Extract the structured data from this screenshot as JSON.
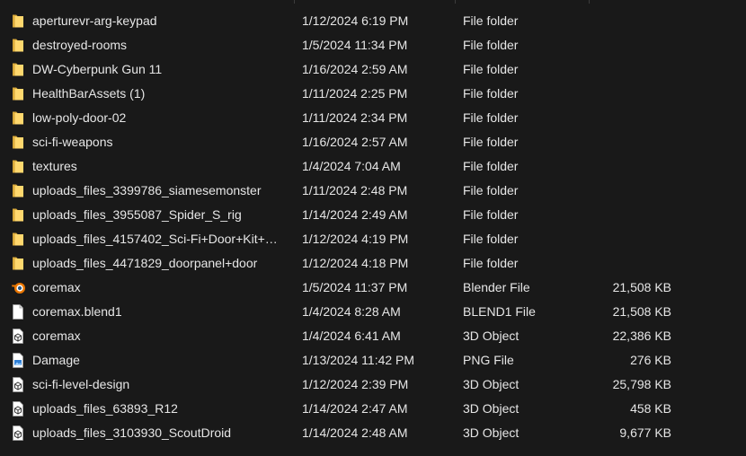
{
  "colors": {
    "background": "#191919",
    "text": "#e6e6e6",
    "folder": "#f2c55c",
    "blender_orange": "#ea7600",
    "blender_blue": "#265787"
  },
  "files": [
    {
      "icon": "folder-icon",
      "name": "aperturevr-arg-keypad",
      "date": "1/12/2024 6:19 PM",
      "type": "File folder",
      "size": ""
    },
    {
      "icon": "folder-icon",
      "name": "destroyed-rooms",
      "date": "1/5/2024 11:34 PM",
      "type": "File folder",
      "size": ""
    },
    {
      "icon": "folder-icon",
      "name": "DW-Cyberpunk Gun 11",
      "date": "1/16/2024 2:59 AM",
      "type": "File folder",
      "size": ""
    },
    {
      "icon": "folder-icon",
      "name": "HealthBarAssets (1)",
      "date": "1/11/2024 2:25 PM",
      "type": "File folder",
      "size": ""
    },
    {
      "icon": "folder-icon",
      "name": "low-poly-door-02",
      "date": "1/11/2024 2:34 PM",
      "type": "File folder",
      "size": ""
    },
    {
      "icon": "folder-icon",
      "name": "sci-fi-weapons",
      "date": "1/16/2024 2:57 AM",
      "type": "File folder",
      "size": ""
    },
    {
      "icon": "folder-icon",
      "name": "textures",
      "date": "1/4/2024 7:04 AM",
      "type": "File folder",
      "size": ""
    },
    {
      "icon": "folder-icon",
      "name": "uploads_files_3399786_siamesemonster",
      "date": "1/11/2024 2:48 PM",
      "type": "File folder",
      "size": ""
    },
    {
      "icon": "folder-icon",
      "name": "uploads_files_3955087_Spider_S_rig",
      "date": "1/14/2024 2:49 AM",
      "type": "File folder",
      "size": ""
    },
    {
      "icon": "folder-icon",
      "name": "uploads_files_4157402_Sci-Fi+Door+Kit+…",
      "date": "1/12/2024 4:19 PM",
      "type": "File folder",
      "size": ""
    },
    {
      "icon": "folder-icon",
      "name": "uploads_files_4471829_doorpanel+door",
      "date": "1/12/2024 4:18 PM",
      "type": "File folder",
      "size": ""
    },
    {
      "icon": "blender-icon",
      "name": "coremax",
      "date": "1/5/2024 11:37 PM",
      "type": "Blender File",
      "size": "21,508 KB"
    },
    {
      "icon": "blank-file-icon",
      "name": "coremax.blend1",
      "date": "1/4/2024 8:28 AM",
      "type": "BLEND1 File",
      "size": "21,508 KB"
    },
    {
      "icon": "3d-object-icon",
      "name": "coremax",
      "date": "1/4/2024 6:41 AM",
      "type": "3D Object",
      "size": "22,386 KB"
    },
    {
      "icon": "png-file-icon",
      "name": "Damage",
      "date": "1/13/2024 11:42 PM",
      "type": "PNG File",
      "size": "276 KB"
    },
    {
      "icon": "3d-object-icon",
      "name": "sci-fi-level-design",
      "date": "1/12/2024 2:39 PM",
      "type": "3D Object",
      "size": "25,798 KB"
    },
    {
      "icon": "3d-object-icon",
      "name": "uploads_files_63893_R12",
      "date": "1/14/2024 2:47 AM",
      "type": "3D Object",
      "size": "458 KB"
    },
    {
      "icon": "3d-object-icon",
      "name": "uploads_files_3103930_ScoutDroid",
      "date": "1/14/2024 2:48 AM",
      "type": "3D Object",
      "size": "9,677 KB"
    }
  ]
}
